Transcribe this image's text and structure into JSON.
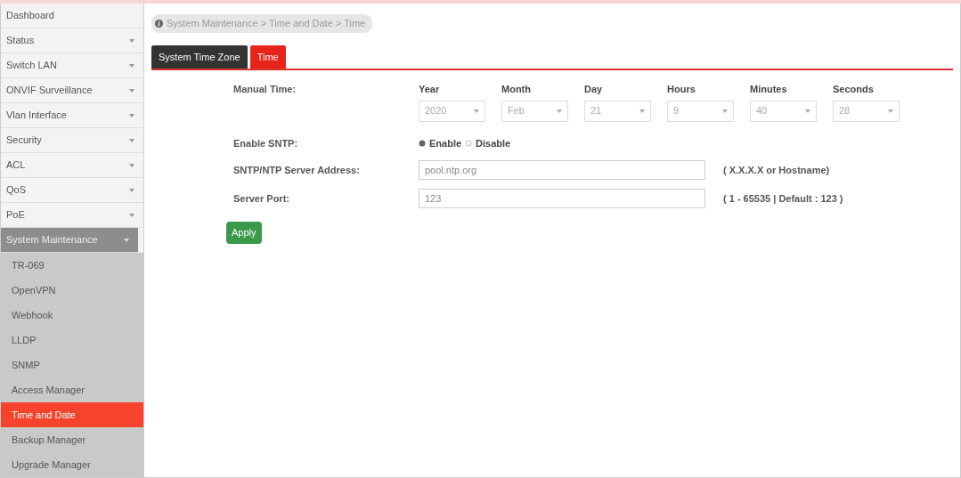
{
  "sidebar": {
    "items": [
      {
        "label": "Dashboard",
        "has_caret": false,
        "expanded": false,
        "selected": false
      },
      {
        "label": "Status",
        "has_caret": true,
        "expanded": false,
        "selected": false
      },
      {
        "label": "Switch LAN",
        "has_caret": true,
        "expanded": false,
        "selected": false
      },
      {
        "label": "ONVIF Surveillance",
        "has_caret": true,
        "expanded": false,
        "selected": false
      },
      {
        "label": "Vlan Interface",
        "has_caret": true,
        "expanded": false,
        "selected": false
      },
      {
        "label": "Security",
        "has_caret": true,
        "expanded": false,
        "selected": false
      },
      {
        "label": "ACL",
        "has_caret": true,
        "expanded": false,
        "selected": false
      },
      {
        "label": "QoS",
        "has_caret": true,
        "expanded": false,
        "selected": false
      },
      {
        "label": "PoE",
        "has_caret": true,
        "expanded": false,
        "selected": false
      },
      {
        "label": "System Maintenance",
        "has_caret": true,
        "expanded": true,
        "selected": false,
        "children": [
          {
            "label": "TR-069",
            "selected": false
          },
          {
            "label": "OpenVPN",
            "selected": false
          },
          {
            "label": "Webhook",
            "selected": false
          },
          {
            "label": "LLDP",
            "selected": false
          },
          {
            "label": "SNMP",
            "selected": false
          },
          {
            "label": "Access Manager",
            "selected": false
          },
          {
            "label": "Time and Date",
            "selected": true
          },
          {
            "label": "Backup Manager",
            "selected": false
          },
          {
            "label": "Upgrade Manager",
            "selected": false
          }
        ]
      }
    ]
  },
  "breadcrumb": "System Maintenance > Time and Date > Time",
  "tabs": [
    {
      "label": "System Time Zone",
      "selected": false
    },
    {
      "label": "Time",
      "selected": true
    }
  ],
  "manual_time": {
    "label": "Manual Time:",
    "fields": [
      {
        "label": "Year",
        "value": "2020",
        "disabled": true
      },
      {
        "label": "Month",
        "value": "Feb",
        "disabled": true
      },
      {
        "label": "Day",
        "value": "21",
        "disabled": true
      },
      {
        "label": "Hours",
        "value": "9",
        "disabled": true
      },
      {
        "label": "Minutes",
        "value": "40",
        "disabled": true
      },
      {
        "label": "Seconds",
        "value": "28",
        "disabled": true
      }
    ]
  },
  "enable_sntp": {
    "label": "Enable SNTP:",
    "options": [
      {
        "label": "Enable",
        "selected": true
      },
      {
        "label": "Disable",
        "selected": false
      }
    ]
  },
  "server_address": {
    "label": "SNTP/NTP Server Address:",
    "value": "pool.ntp.org",
    "hint": "( X.X.X.X or Hostname)"
  },
  "server_port": {
    "label": "Server Port:",
    "value": "123",
    "hint": "( 1 - 65535 | Default : 123 )"
  },
  "apply_button": "Apply"
}
